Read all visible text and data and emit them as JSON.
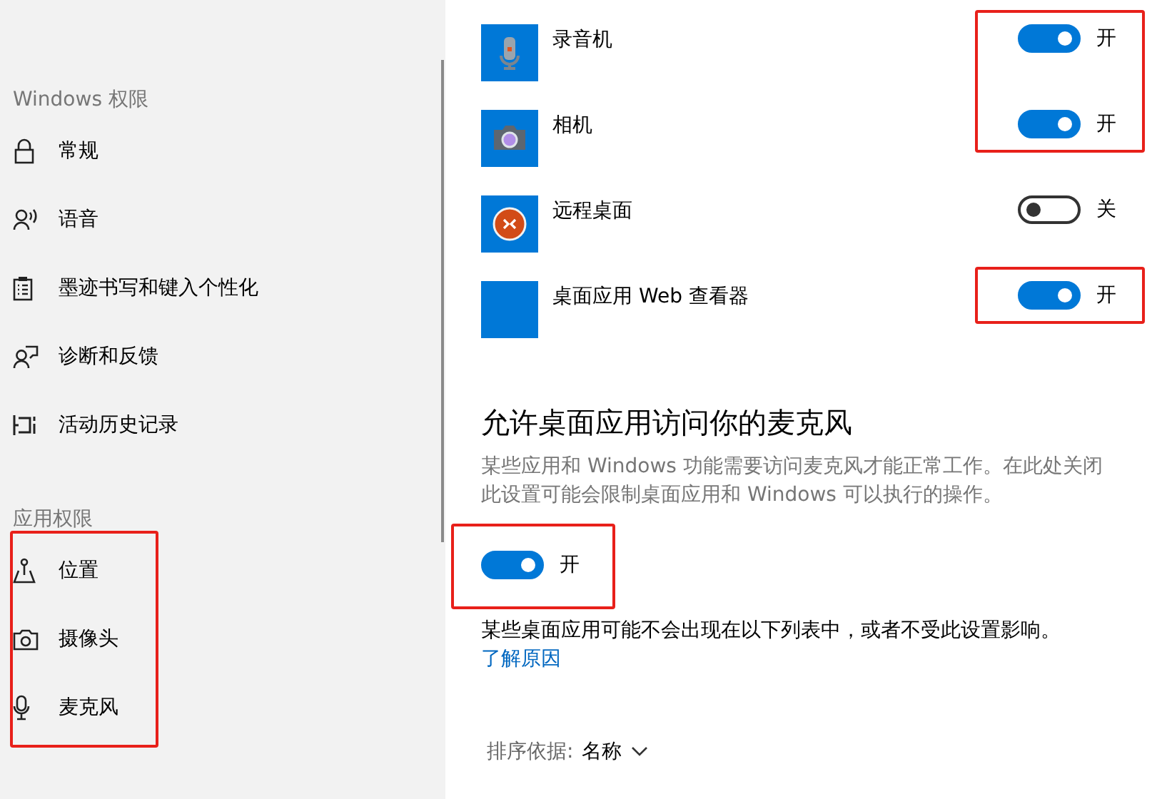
{
  "sidebar": {
    "sections": [
      {
        "heading": "Windows 权限",
        "items": [
          {
            "label": "常规",
            "kind": "lock",
            "highlighted": false
          },
          {
            "label": "语音",
            "kind": "voice",
            "highlighted": false
          },
          {
            "label": "墨迹书写和键入个性化",
            "kind": "clipboard",
            "highlighted": false
          },
          {
            "label": "诊断和反馈",
            "kind": "feedback",
            "highlighted": false
          },
          {
            "label": "活动历史记录",
            "kind": "history",
            "highlighted": false
          }
        ]
      },
      {
        "heading": "应用权限",
        "items": [
          {
            "label": "位置",
            "kind": "location",
            "highlighted": true
          },
          {
            "label": "摄像头",
            "kind": "camera",
            "highlighted": true
          },
          {
            "label": "麦克风",
            "kind": "mic",
            "highlighted": true
          }
        ]
      }
    ]
  },
  "apps": [
    {
      "name": "录音机",
      "kind": "recorder",
      "on": true,
      "state": "开",
      "highlighted": true
    },
    {
      "name": "相机",
      "kind": "camera",
      "on": true,
      "state": "开",
      "highlighted": true
    },
    {
      "name": "远程桌面",
      "kind": "remote",
      "on": false,
      "state": "关",
      "highlighted": false
    },
    {
      "name": "桌面应用 Web 查看器",
      "kind": "blank",
      "on": true,
      "state": "开",
      "highlighted": true
    }
  ],
  "section": {
    "title": "允许桌面应用访问你的麦克风",
    "description": "某些应用和 Windows 功能需要访问麦克风才能正常工作。在此处关闭此设置可能会限制桌面应用和 Windows 可以执行的操作。",
    "toggle": {
      "on": true,
      "state": "开",
      "highlighted": true
    },
    "note": "某些桌面应用可能不会出现在以下列表中，或者不受此设置影响。",
    "link": "了解原因"
  },
  "sort": {
    "label": "排序依据:",
    "value": "名称"
  }
}
